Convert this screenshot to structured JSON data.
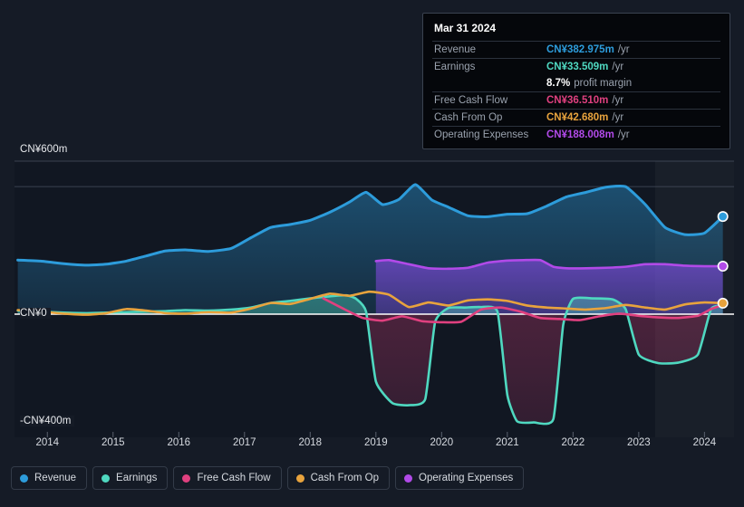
{
  "chart_data": {
    "type": "area",
    "title": "",
    "xlabel": "",
    "ylabel": "",
    "currency_prefix": "CN¥",
    "xlim": [
      2013.5,
      2024.45
    ],
    "ylim": [
      -400,
      640
    ],
    "grid": true,
    "legend_position": "bottom-left",
    "y_ticks": [
      {
        "value": 600,
        "label": "CN¥600m"
      },
      {
        "value": 0,
        "label": "CN¥0"
      },
      {
        "value": -400,
        "label": "-CN¥400m"
      }
    ],
    "x_ticks": [
      {
        "value": 2014,
        "label": "2014"
      },
      {
        "value": 2015,
        "label": "2015"
      },
      {
        "value": 2016,
        "label": "2016"
      },
      {
        "value": 2017,
        "label": "2017"
      },
      {
        "value": 2018,
        "label": "2018"
      },
      {
        "value": 2019,
        "label": "2019"
      },
      {
        "value": 2020,
        "label": "2020"
      },
      {
        "value": 2021,
        "label": "2021"
      },
      {
        "value": 2022,
        "label": "2022"
      },
      {
        "value": 2023,
        "label": "2023"
      },
      {
        "value": 2024,
        "label": "2024"
      }
    ],
    "gridlines_y": [
      600,
      500
    ],
    "highlight_band": {
      "from": 2023.25,
      "to": 2024.45
    },
    "series": [
      {
        "name": "Revenue",
        "color": "#2d9cdb",
        "fill": "#1d4a66",
        "x": [
          2013.55,
          2013.9,
          2014.25,
          2014.6,
          2014.9,
          2015.2,
          2015.5,
          2015.8,
          2016.1,
          2016.45,
          2016.8,
          2017.1,
          2017.4,
          2017.7,
          2018.0,
          2018.3,
          2018.6,
          2018.85,
          2019.1,
          2019.35,
          2019.6,
          2019.85,
          2020.1,
          2020.4,
          2020.7,
          2021.0,
          2021.3,
          2021.6,
          2021.9,
          2022.2,
          2022.5,
          2022.8,
          2023.1,
          2023.4,
          2023.7,
          2024.0,
          2024.28
        ],
        "values": [
          212,
          208,
          198,
          192,
          196,
          208,
          228,
          248,
          252,
          246,
          258,
          300,
          340,
          352,
          368,
          400,
          440,
          478,
          430,
          450,
          508,
          448,
          420,
          386,
          382,
          392,
          394,
          424,
          460,
          478,
          498,
          500,
          430,
          340,
          312,
          318,
          383
        ]
      },
      {
        "name": "Earnings",
        "color": "#4fd8c0",
        "fill_positive": "#2f6b63",
        "fill_negative": "#5c2030",
        "x": [
          2013.55,
          2013.9,
          2014.25,
          2014.6,
          2014.9,
          2015.2,
          2015.5,
          2015.8,
          2016.1,
          2016.45,
          2016.8,
          2017.1,
          2017.4,
          2017.7,
          2018.0,
          2018.3,
          2018.55,
          2018.7,
          2018.85,
          2019.0,
          2019.25,
          2019.5,
          2019.75,
          2019.9,
          2020.1,
          2020.35,
          2020.6,
          2020.85,
          2021.0,
          2021.15,
          2021.4,
          2021.7,
          2021.85,
          2022.0,
          2022.3,
          2022.6,
          2022.8,
          2023.0,
          2023.3,
          2023.6,
          2023.9,
          2024.1,
          2024.28
        ],
        "values": [
          14,
          10,
          6,
          4,
          6,
          8,
          10,
          12,
          16,
          14,
          18,
          26,
          44,
          52,
          62,
          70,
          74,
          60,
          10,
          -250,
          -330,
          -338,
          -316,
          -30,
          24,
          26,
          28,
          10,
          -300,
          -398,
          -402,
          -390,
          -40,
          60,
          62,
          58,
          20,
          -150,
          -182,
          -180,
          -150,
          20,
          34
        ]
      },
      {
        "name": "Free Cash Flow",
        "color": "#e0407f",
        "x": [
          2018.2,
          2018.5,
          2018.8,
          2019.1,
          2019.4,
          2019.7,
          2020.0,
          2020.3,
          2020.6,
          2020.9,
          2021.2,
          2021.5,
          2021.8,
          2022.1,
          2022.4,
          2022.7,
          2023.0,
          2023.3,
          2023.6,
          2023.9,
          2024.1,
          2024.28
        ],
        "values": [
          62,
          22,
          -14,
          -24,
          -8,
          -26,
          -30,
          -28,
          18,
          26,
          10,
          -14,
          -18,
          -22,
          -8,
          2,
          -6,
          -12,
          -14,
          -6,
          20,
          36
        ]
      },
      {
        "name": "Cash From Op",
        "color": "#e8a33d",
        "x": [
          2013.55,
          2013.9,
          2014.25,
          2014.6,
          2014.9,
          2015.2,
          2015.5,
          2015.8,
          2016.1,
          2016.45,
          2016.8,
          2017.1,
          2017.4,
          2017.7,
          2018.0,
          2018.3,
          2018.6,
          2018.9,
          2019.2,
          2019.5,
          2019.8,
          2020.1,
          2020.4,
          2020.7,
          2021.0,
          2021.3,
          2021.6,
          2021.9,
          2022.2,
          2022.5,
          2022.8,
          2023.1,
          2023.4,
          2023.7,
          2024.0,
          2024.28
        ],
        "values": [
          16,
          10,
          2,
          -2,
          4,
          20,
          14,
          4,
          2,
          8,
          6,
          22,
          44,
          40,
          60,
          80,
          72,
          88,
          76,
          28,
          46,
          34,
          54,
          58,
          52,
          34,
          26,
          22,
          18,
          24,
          36,
          26,
          18,
          38,
          46,
          43
        ]
      },
      {
        "name": "Operating Expenses",
        "color": "#b14ae8",
        "fill": "#3e2f70",
        "x": [
          2019.0,
          2019.2,
          2019.5,
          2019.8,
          2020.1,
          2020.4,
          2020.7,
          2021.0,
          2021.25,
          2021.5,
          2021.7,
          2021.9,
          2022.2,
          2022.5,
          2022.8,
          2023.1,
          2023.4,
          2023.7,
          2024.0,
          2024.28
        ],
        "values": [
          208,
          212,
          196,
          180,
          178,
          182,
          202,
          210,
          212,
          212,
          186,
          180,
          180,
          182,
          186,
          196,
          196,
          190,
          188,
          188
        ]
      }
    ],
    "endpoints": [
      {
        "series": "Revenue",
        "x": 2024.28,
        "value": 383,
        "color": "#2d9cdb"
      },
      {
        "series": "Operating Expenses",
        "x": 2024.28,
        "value": 188,
        "color": "#b14ae8"
      },
      {
        "series": "Cash From Op",
        "x": 2024.28,
        "value": 43,
        "color": "#e8a33d"
      }
    ]
  },
  "tooltip": {
    "date": "Mar 31 2024",
    "rows": [
      {
        "label": "Revenue",
        "value": "CN¥382.975m",
        "unit": "/yr",
        "color": "#2d9cdb"
      },
      {
        "label": "Earnings",
        "value": "CN¥33.509m",
        "unit": "/yr",
        "color": "#4fd8c0"
      },
      {
        "label": "",
        "margin_value": "8.7%",
        "margin_text": "profit margin"
      },
      {
        "label": "Free Cash Flow",
        "value": "CN¥36.510m",
        "unit": "/yr",
        "color": "#e0407f"
      },
      {
        "label": "Cash From Op",
        "value": "CN¥42.680m",
        "unit": "/yr",
        "color": "#e8a33d"
      },
      {
        "label": "Operating Expenses",
        "value": "CN¥188.008m",
        "unit": "/yr",
        "color": "#b14ae8"
      }
    ]
  },
  "legend": {
    "items": [
      {
        "label": "Revenue",
        "color": "#2d9cdb"
      },
      {
        "label": "Earnings",
        "color": "#4fd8c0"
      },
      {
        "label": "Free Cash Flow",
        "color": "#e0407f"
      },
      {
        "label": "Cash From Op",
        "color": "#e8a33d"
      },
      {
        "label": "Operating Expenses",
        "color": "#b14ae8"
      }
    ]
  }
}
